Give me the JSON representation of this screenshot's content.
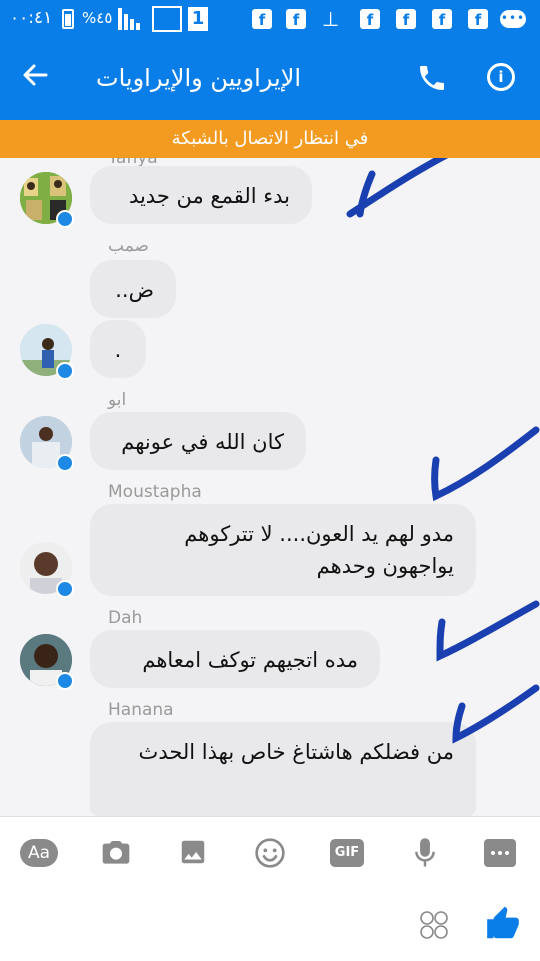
{
  "status_bar": {
    "time": "٠٠:٤١",
    "battery": "%٤٥",
    "sim_label": "1",
    "fb_icon_letter": "f",
    "chat_icon": "•••"
  },
  "header": {
    "title": "الإيراويين والإيراويات",
    "back_icon": "arrow-left-icon",
    "call_icon": "phone-icon",
    "info_icon": "info-icon",
    "info_glyph": "i",
    "bg_color": "#0a7ee8"
  },
  "banner": {
    "text": "في انتظار الاتصال بالشبكة",
    "color": "#f39b20"
  },
  "messages": [
    {
      "sender": "Yahya",
      "text": "بدء القمع من جديد"
    },
    {
      "sender": "صمب",
      "text": "ض.."
    },
    {
      "sender": "",
      "text": "."
    },
    {
      "sender": "ابو",
      "text": "كان الله في عونهم"
    },
    {
      "sender": "Moustapha",
      "text": "مدو لهم يد العون.... لا تتركوهم يواجهون وحدهم"
    },
    {
      "sender": "Dah",
      "text": "مده اتجيهم توكف امعاهم"
    },
    {
      "sender": "Hanana",
      "text": "من فضلكم هاشتاغ خاص بهذا الحدث"
    }
  ],
  "composer": {
    "text_button": "Aa",
    "gif_button": "GIF",
    "tools": [
      "text-format-icon",
      "camera-icon",
      "image-icon",
      "emoji-icon",
      "gif-icon",
      "microphone-icon",
      "more-icon"
    ],
    "reactions_icon": "reactions-icon",
    "like_icon": "thumbs-up-icon"
  }
}
